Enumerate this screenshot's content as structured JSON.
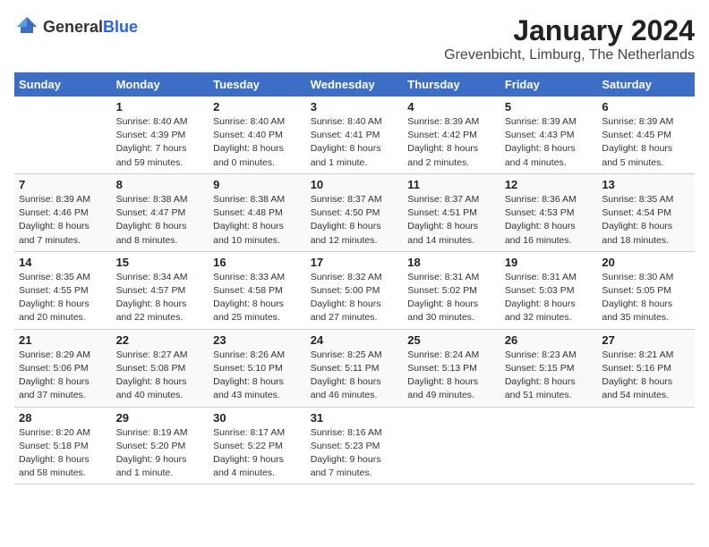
{
  "logo": {
    "general": "General",
    "blue": "Blue"
  },
  "title": "January 2024",
  "subtitle": "Grevenbicht, Limburg, The Netherlands",
  "headers": [
    "Sunday",
    "Monday",
    "Tuesday",
    "Wednesday",
    "Thursday",
    "Friday",
    "Saturday"
  ],
  "weeks": [
    [
      {
        "day": "",
        "sunrise": "",
        "sunset": "",
        "daylight": ""
      },
      {
        "day": "1",
        "sunrise": "Sunrise: 8:40 AM",
        "sunset": "Sunset: 4:39 PM",
        "daylight": "Daylight: 7 hours and 59 minutes."
      },
      {
        "day": "2",
        "sunrise": "Sunrise: 8:40 AM",
        "sunset": "Sunset: 4:40 PM",
        "daylight": "Daylight: 8 hours and 0 minutes."
      },
      {
        "day": "3",
        "sunrise": "Sunrise: 8:40 AM",
        "sunset": "Sunset: 4:41 PM",
        "daylight": "Daylight: 8 hours and 1 minute."
      },
      {
        "day": "4",
        "sunrise": "Sunrise: 8:39 AM",
        "sunset": "Sunset: 4:42 PM",
        "daylight": "Daylight: 8 hours and 2 minutes."
      },
      {
        "day": "5",
        "sunrise": "Sunrise: 8:39 AM",
        "sunset": "Sunset: 4:43 PM",
        "daylight": "Daylight: 8 hours and 4 minutes."
      },
      {
        "day": "6",
        "sunrise": "Sunrise: 8:39 AM",
        "sunset": "Sunset: 4:45 PM",
        "daylight": "Daylight: 8 hours and 5 minutes."
      }
    ],
    [
      {
        "day": "7",
        "sunrise": "Sunrise: 8:39 AM",
        "sunset": "Sunset: 4:46 PM",
        "daylight": "Daylight: 8 hours and 7 minutes."
      },
      {
        "day": "8",
        "sunrise": "Sunrise: 8:38 AM",
        "sunset": "Sunset: 4:47 PM",
        "daylight": "Daylight: 8 hours and 8 minutes."
      },
      {
        "day": "9",
        "sunrise": "Sunrise: 8:38 AM",
        "sunset": "Sunset: 4:48 PM",
        "daylight": "Daylight: 8 hours and 10 minutes."
      },
      {
        "day": "10",
        "sunrise": "Sunrise: 8:37 AM",
        "sunset": "Sunset: 4:50 PM",
        "daylight": "Daylight: 8 hours and 12 minutes."
      },
      {
        "day": "11",
        "sunrise": "Sunrise: 8:37 AM",
        "sunset": "Sunset: 4:51 PM",
        "daylight": "Daylight: 8 hours and 14 minutes."
      },
      {
        "day": "12",
        "sunrise": "Sunrise: 8:36 AM",
        "sunset": "Sunset: 4:53 PM",
        "daylight": "Daylight: 8 hours and 16 minutes."
      },
      {
        "day": "13",
        "sunrise": "Sunrise: 8:35 AM",
        "sunset": "Sunset: 4:54 PM",
        "daylight": "Daylight: 8 hours and 18 minutes."
      }
    ],
    [
      {
        "day": "14",
        "sunrise": "Sunrise: 8:35 AM",
        "sunset": "Sunset: 4:55 PM",
        "daylight": "Daylight: 8 hours and 20 minutes."
      },
      {
        "day": "15",
        "sunrise": "Sunrise: 8:34 AM",
        "sunset": "Sunset: 4:57 PM",
        "daylight": "Daylight: 8 hours and 22 minutes."
      },
      {
        "day": "16",
        "sunrise": "Sunrise: 8:33 AM",
        "sunset": "Sunset: 4:58 PM",
        "daylight": "Daylight: 8 hours and 25 minutes."
      },
      {
        "day": "17",
        "sunrise": "Sunrise: 8:32 AM",
        "sunset": "Sunset: 5:00 PM",
        "daylight": "Daylight: 8 hours and 27 minutes."
      },
      {
        "day": "18",
        "sunrise": "Sunrise: 8:31 AM",
        "sunset": "Sunset: 5:02 PM",
        "daylight": "Daylight: 8 hours and 30 minutes."
      },
      {
        "day": "19",
        "sunrise": "Sunrise: 8:31 AM",
        "sunset": "Sunset: 5:03 PM",
        "daylight": "Daylight: 8 hours and 32 minutes."
      },
      {
        "day": "20",
        "sunrise": "Sunrise: 8:30 AM",
        "sunset": "Sunset: 5:05 PM",
        "daylight": "Daylight: 8 hours and 35 minutes."
      }
    ],
    [
      {
        "day": "21",
        "sunrise": "Sunrise: 8:29 AM",
        "sunset": "Sunset: 5:06 PM",
        "daylight": "Daylight: 8 hours and 37 minutes."
      },
      {
        "day": "22",
        "sunrise": "Sunrise: 8:27 AM",
        "sunset": "Sunset: 5:08 PM",
        "daylight": "Daylight: 8 hours and 40 minutes."
      },
      {
        "day": "23",
        "sunrise": "Sunrise: 8:26 AM",
        "sunset": "Sunset: 5:10 PM",
        "daylight": "Daylight: 8 hours and 43 minutes."
      },
      {
        "day": "24",
        "sunrise": "Sunrise: 8:25 AM",
        "sunset": "Sunset: 5:11 PM",
        "daylight": "Daylight: 8 hours and 46 minutes."
      },
      {
        "day": "25",
        "sunrise": "Sunrise: 8:24 AM",
        "sunset": "Sunset: 5:13 PM",
        "daylight": "Daylight: 8 hours and 49 minutes."
      },
      {
        "day": "26",
        "sunrise": "Sunrise: 8:23 AM",
        "sunset": "Sunset: 5:15 PM",
        "daylight": "Daylight: 8 hours and 51 minutes."
      },
      {
        "day": "27",
        "sunrise": "Sunrise: 8:21 AM",
        "sunset": "Sunset: 5:16 PM",
        "daylight": "Daylight: 8 hours and 54 minutes."
      }
    ],
    [
      {
        "day": "28",
        "sunrise": "Sunrise: 8:20 AM",
        "sunset": "Sunset: 5:18 PM",
        "daylight": "Daylight: 8 hours and 58 minutes."
      },
      {
        "day": "29",
        "sunrise": "Sunrise: 8:19 AM",
        "sunset": "Sunset: 5:20 PM",
        "daylight": "Daylight: 9 hours and 1 minute."
      },
      {
        "day": "30",
        "sunrise": "Sunrise: 8:17 AM",
        "sunset": "Sunset: 5:22 PM",
        "daylight": "Daylight: 9 hours and 4 minutes."
      },
      {
        "day": "31",
        "sunrise": "Sunrise: 8:16 AM",
        "sunset": "Sunset: 5:23 PM",
        "daylight": "Daylight: 9 hours and 7 minutes."
      },
      {
        "day": "",
        "sunrise": "",
        "sunset": "",
        "daylight": ""
      },
      {
        "day": "",
        "sunrise": "",
        "sunset": "",
        "daylight": ""
      },
      {
        "day": "",
        "sunrise": "",
        "sunset": "",
        "daylight": ""
      }
    ]
  ]
}
